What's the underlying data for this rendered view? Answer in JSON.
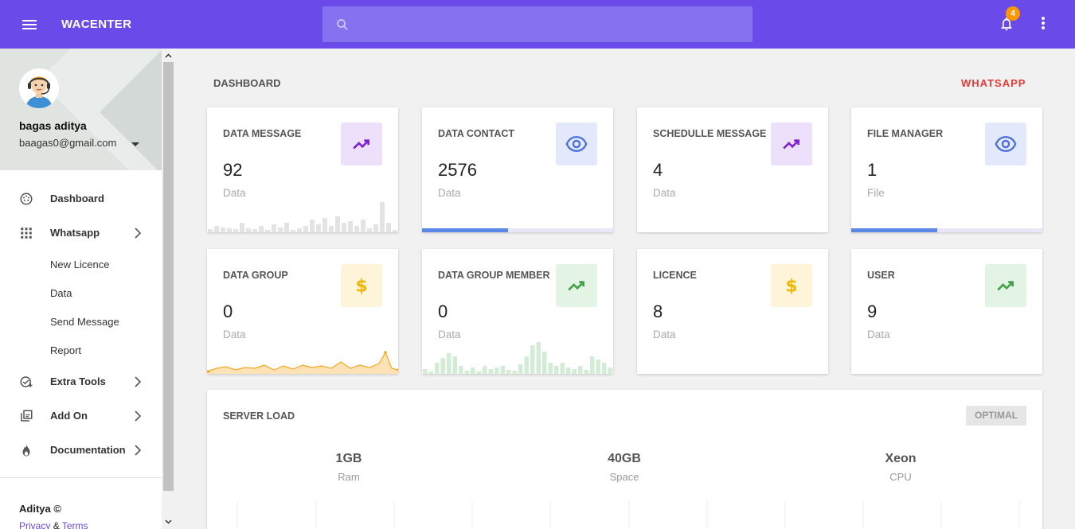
{
  "header": {
    "brand": "WACENTER",
    "search_placeholder": "",
    "notification_count": "4",
    "icons": [
      "menu-icon",
      "search-icon",
      "bell-icon",
      "more-vert-icon"
    ],
    "color": "#6a4ae8"
  },
  "sidebar": {
    "user": {
      "name": "bagas aditya",
      "email": "baagas0@gmail.com"
    },
    "items": [
      {
        "label": "Dashboard",
        "icon": "dashboard-icon"
      },
      {
        "label": "Whatsapp",
        "icon": "apps-grid-icon"
      },
      {
        "label": "Extra Tools",
        "icon": "tools-icon"
      },
      {
        "label": "Add On",
        "icon": "library-icon"
      },
      {
        "label": "Documentation",
        "icon": "fire-icon"
      }
    ],
    "submenu": [
      "New Licence",
      "Data",
      "Send Message",
      "Report"
    ],
    "footer": {
      "copyright": "Aditya ©",
      "privacy": "Privacy",
      "amp": "&",
      "terms": "Terms"
    }
  },
  "main": {
    "title": "DASHBOARD",
    "crumb": "WHATSAPP",
    "cards": [
      {
        "title": "DATA MESSAGE",
        "value": "92",
        "unit": "Data",
        "icon": "trending-up-icon"
      },
      {
        "title": "DATA CONTACT",
        "value": "2576",
        "unit": "Data",
        "icon": "eye-icon",
        "progress": 0.45
      },
      {
        "title": "SCHEDULLE MESSAGE",
        "value": "4",
        "unit": "Data",
        "icon": "trending-up-icon"
      },
      {
        "title": "FILE MANAGER",
        "value": "1",
        "unit": "File",
        "icon": "eye-icon",
        "progress": 0.45
      },
      {
        "title": "DATA GROUP",
        "value": "0",
        "unit": "Data",
        "icon": "dollar-icon"
      },
      {
        "title": "DATA GROUP MEMBER",
        "value": "0",
        "unit": "Data",
        "icon": "trending-up-icon"
      },
      {
        "title": "LICENCE",
        "value": "8",
        "unit": "Data",
        "icon": "dollar-icon"
      },
      {
        "title": "USER",
        "value": "9",
        "unit": "Data",
        "icon": "trending-up-icon"
      }
    ],
    "server": {
      "title": "SERVER LOAD",
      "badge": "OPTIMAL",
      "stats": [
        {
          "value": "1GB",
          "label": "Ram"
        },
        {
          "value": "40GB",
          "label": "Space"
        },
        {
          "value": "Xeon",
          "label": "CPU"
        }
      ]
    }
  }
}
